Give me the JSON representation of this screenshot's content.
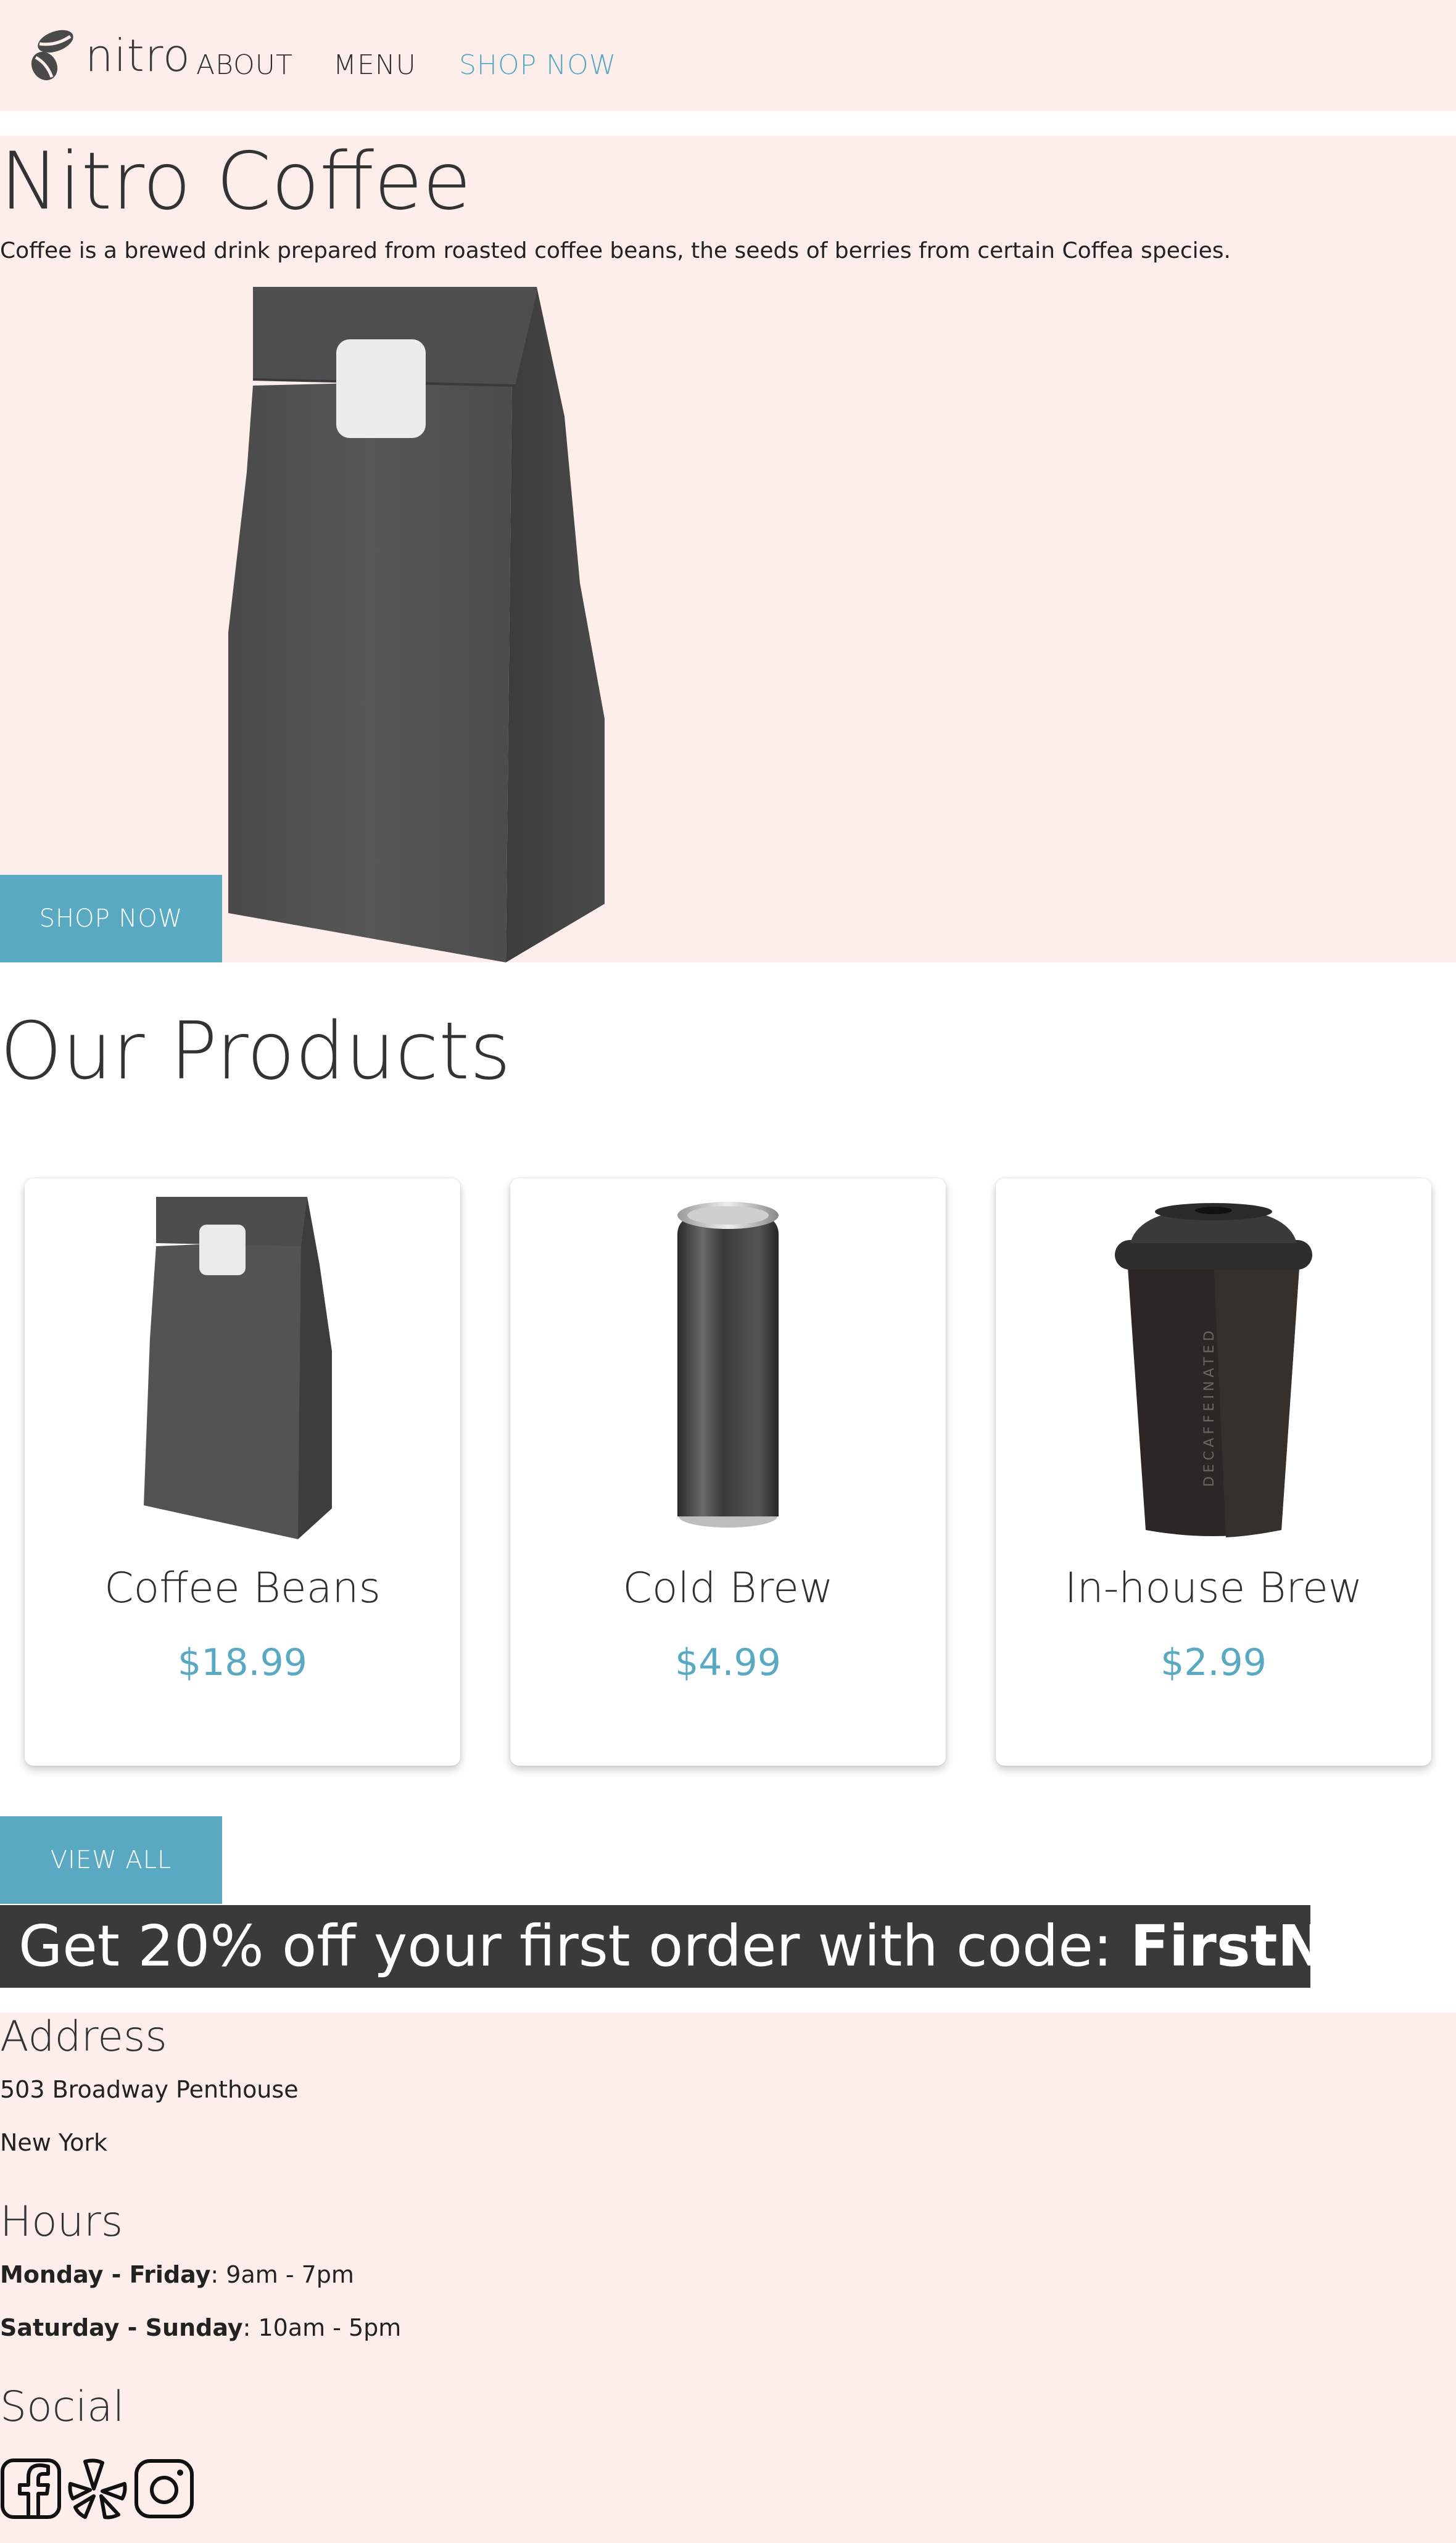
{
  "header": {
    "logo_text": "nitro",
    "nav": [
      {
        "label": "ABOUT"
      },
      {
        "label": "MENU"
      },
      {
        "label": "SHOP NOW"
      }
    ]
  },
  "hero": {
    "title": "Nitro Coffee",
    "description": "Coffee is a brewed drink prepared from roasted coffee beans, the seeds of berries from certain Coffea species.",
    "button_label": "SHOP NOW"
  },
  "products": {
    "title": "Our Products",
    "items": [
      {
        "name": "Coffee Beans",
        "price": "$18.99",
        "icon": "coffee-bag-icon"
      },
      {
        "name": "Cold Brew",
        "price": "$4.99",
        "icon": "can-icon"
      },
      {
        "name": "In-house Brew",
        "price": "$2.99",
        "icon": "cup-icon",
        "cup_text": "DECAFFEINATED"
      }
    ],
    "view_all_label": "VIEW ALL"
  },
  "promo": {
    "text": "Get 20% off your first order with code: ",
    "code": "FirstNitro"
  },
  "footer": {
    "address_heading": "Address",
    "address_line1": "503 Broadway Penthouse",
    "address_line2": "New York",
    "hours_heading": "Hours",
    "hours": [
      {
        "days": "Monday - Friday",
        "time": ": 9am - 7pm"
      },
      {
        "days": "Saturday - Sunday",
        "time": ": 10am - 5pm"
      }
    ],
    "social_heading": "Social",
    "social_icons": [
      "facebook-icon",
      "yelp-icon",
      "instagram-icon"
    ]
  },
  "colors": {
    "accent": "#5aa9c2",
    "background_pink": "#fdeeeb",
    "promo_bg": "#3a3a3a"
  }
}
